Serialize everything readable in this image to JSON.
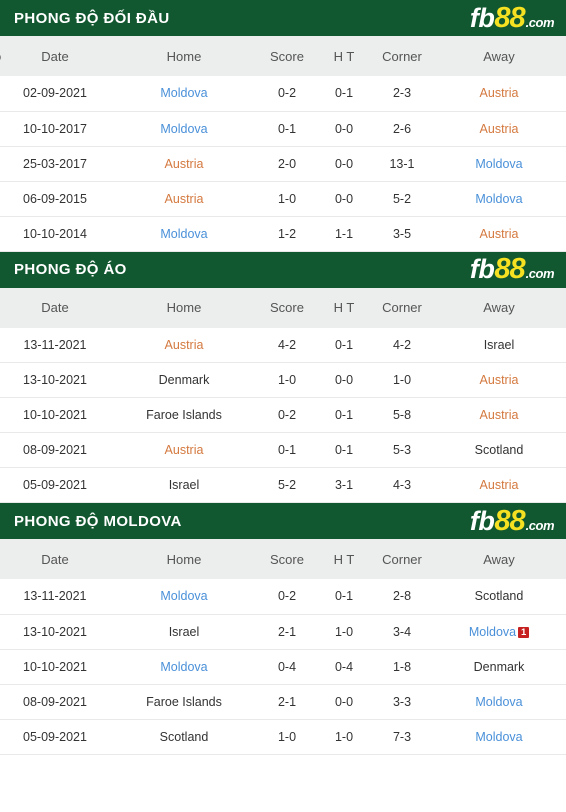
{
  "brand": {
    "fb": "fb",
    "eightyeight": "88",
    "dotcom": ".com",
    "yellow": "#f5e021",
    "green": "#11572f"
  },
  "colors": {
    "header_green": "#11572f",
    "logo_yellow": "#f5e021",
    "score_red": "#d93025",
    "team_blue": "#4a90d9",
    "team_orange": "#d4793f",
    "card_red": "#c62020",
    "table_header_bg": "#eceded"
  },
  "columns": {
    "date": "Date",
    "home": "Home",
    "score": "Score",
    "ht": "H T",
    "corner": "Corner",
    "away": "Away",
    "clipped": "ọ"
  },
  "sections": [
    {
      "title": "PHONG ĐỘ ĐỐI ĐẦU",
      "show_clipped_glyph": true,
      "rows": [
        {
          "date": "02-09-2021",
          "home": "Moldova",
          "home_style": "team-blue",
          "home_card": null,
          "score": "0-2",
          "ht": "0-1",
          "corner": "2-3",
          "away": "Austria",
          "away_style": "team-orange",
          "away_card": null
        },
        {
          "date": "10-10-2017",
          "home": "Moldova",
          "home_style": "team-blue",
          "home_card": null,
          "score": "0-1",
          "ht": "0-0",
          "corner": "2-6",
          "away": "Austria",
          "away_style": "team-orange",
          "away_card": null
        },
        {
          "date": "25-03-2017",
          "home": "Austria",
          "home_style": "team-orange",
          "home_card": null,
          "score": "2-0",
          "ht": "0-0",
          "corner": "13-1",
          "away": "Moldova",
          "away_style": "team-blue",
          "away_card": null
        },
        {
          "date": "06-09-2015",
          "home": "Austria",
          "home_style": "team-orange",
          "home_card": null,
          "score": "1-0",
          "ht": "0-0",
          "corner": "5-2",
          "away": "Moldova",
          "away_style": "team-blue",
          "away_card": null
        },
        {
          "date": "10-10-2014",
          "home": "Moldova",
          "home_style": "team-blue",
          "home_card": null,
          "score": "1-2",
          "ht": "1-1",
          "corner": "3-5",
          "away": "Austria",
          "away_style": "team-orange",
          "away_card": null
        }
      ]
    },
    {
      "title": "PHONG ĐỘ ÁO",
      "show_clipped_glyph": false,
      "rows": [
        {
          "date": "13-11-2021",
          "home": "Austria",
          "home_style": "team-orange",
          "home_card": null,
          "score": "4-2",
          "ht": "0-1",
          "corner": "4-2",
          "away": "Israel",
          "away_style": "team-plain",
          "away_card": null
        },
        {
          "date": "13-10-2021",
          "home": "Denmark",
          "home_style": "team-plain",
          "home_card": null,
          "score": "1-0",
          "ht": "0-0",
          "corner": "1-0",
          "away": "Austria",
          "away_style": "team-orange",
          "away_card": null
        },
        {
          "date": "10-10-2021",
          "home": "Faroe Islands",
          "home_style": "team-plain",
          "home_card": null,
          "score": "0-2",
          "ht": "0-1",
          "corner": "5-8",
          "away": "Austria",
          "away_style": "team-orange",
          "away_card": null
        },
        {
          "date": "08-09-2021",
          "home": "Austria",
          "home_style": "team-orange",
          "home_card": null,
          "score": "0-1",
          "ht": "0-1",
          "corner": "5-3",
          "away": "Scotland",
          "away_style": "team-plain",
          "away_card": null
        },
        {
          "date": "05-09-2021",
          "home": "Israel",
          "home_style": "team-plain",
          "home_card": null,
          "score": "5-2",
          "ht": "3-1",
          "corner": "4-3",
          "away": "Austria",
          "away_style": "team-orange",
          "away_card": null
        }
      ]
    },
    {
      "title": "PHONG ĐỘ MOLDOVA",
      "show_clipped_glyph": false,
      "rows": [
        {
          "date": "13-11-2021",
          "home": "Moldova",
          "home_style": "team-blue",
          "home_card": null,
          "score": "0-2",
          "ht": "0-1",
          "corner": "2-8",
          "away": "Scotland",
          "away_style": "team-plain",
          "away_card": null
        },
        {
          "date": "13-10-2021",
          "home": "Israel",
          "home_style": "team-plain",
          "home_card": null,
          "score": "2-1",
          "ht": "1-0",
          "corner": "3-4",
          "away": "Moldova",
          "away_style": "team-blue",
          "away_card": "1"
        },
        {
          "date": "10-10-2021",
          "home": "Moldova",
          "home_style": "team-blue",
          "home_card": null,
          "score": "0-4",
          "ht": "0-4",
          "corner": "1-8",
          "away": "Denmark",
          "away_style": "team-plain",
          "away_card": null
        },
        {
          "date": "08-09-2021",
          "home": "Faroe Islands",
          "home_style": "team-plain",
          "home_card": null,
          "score": "2-1",
          "ht": "0-0",
          "corner": "3-3",
          "away": "Moldova",
          "away_style": "team-blue",
          "away_card": null
        },
        {
          "date": "05-09-2021",
          "home": "Scotland",
          "home_style": "team-plain",
          "home_card": null,
          "score": "1-0",
          "ht": "1-0",
          "corner": "7-3",
          "away": "Moldova",
          "away_style": "team-blue",
          "away_card": null
        }
      ]
    }
  ]
}
